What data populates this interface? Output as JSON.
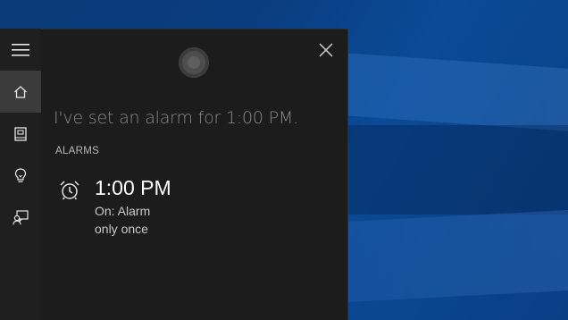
{
  "cortana": {
    "response_text": "I've set an alarm for 1:00 PM."
  },
  "nav": {
    "items": [
      {
        "id": "menu",
        "icon": "hamburger-icon",
        "active": false
      },
      {
        "id": "home",
        "icon": "home-icon",
        "active": true
      },
      {
        "id": "notebook",
        "icon": "notebook-icon",
        "active": false
      },
      {
        "id": "reminders",
        "icon": "lightbulb-icon",
        "active": false
      },
      {
        "id": "feedback",
        "icon": "feedback-icon",
        "active": false
      }
    ]
  },
  "alarms": {
    "section_label": "ALARMS",
    "items": [
      {
        "time": "1:00 PM",
        "state": "On: Alarm",
        "repeat": "only once",
        "icon": "alarm-clock-icon"
      }
    ]
  },
  "colors": {
    "nav_bg": "#1f1f1f",
    "panel_bg": "#1c1c1c",
    "active_nav": "#3b3b3b",
    "desktop_blue": "#0a3d80"
  }
}
